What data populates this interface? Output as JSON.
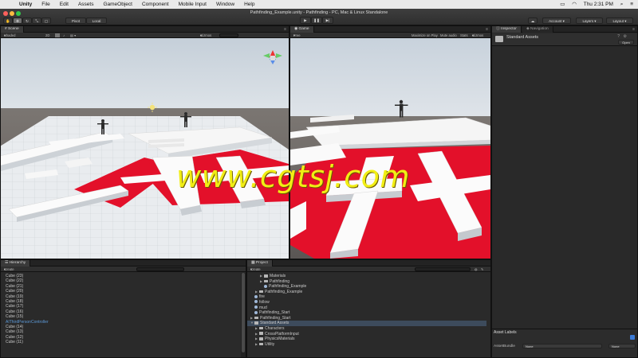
{
  "menubar": {
    "apple_icon": "apple-icon",
    "items": [
      "Unity",
      "File",
      "Edit",
      "Assets",
      "GameObject",
      "Component",
      "Mobile Input",
      "Window",
      "Help"
    ],
    "clock": "Thu 2:31 PM"
  },
  "window": {
    "title": "Pathfinding_Example.unity - Pathfinding - PC, Mac & Linux Standalone"
  },
  "toolbar": {
    "pivot": "Pivot",
    "local": "Local",
    "account": "Account",
    "layers": "Layers",
    "layout": "Layout"
  },
  "scene": {
    "tab": "Scene",
    "shading": "Shaded",
    "mode_2d": "2D",
    "gizmos": "Gizmos"
  },
  "game": {
    "tab": "Game",
    "aspect": "Free Aspect",
    "maximize": "Maximize on Play",
    "mute": "Mute audio",
    "stats": "Stats",
    "gizmos": "Gizmos",
    "watermark": "www.cgtsj.com"
  },
  "inspector": {
    "tab": "Inspector",
    "nav_tab": "Navigation",
    "item": "Standard Assets",
    "open_button": "Open",
    "asset_labels": "Asset Labels",
    "asset_bundle_label": "AssetBundle",
    "bundle_value": "None",
    "variant_value": "None"
  },
  "hierarchy": {
    "tab": "Hierarchy",
    "create": "Create",
    "items": [
      {
        "label": "Cube (23)",
        "style": ""
      },
      {
        "label": "Cube (22)",
        "style": ""
      },
      {
        "label": "Cube (21)",
        "style": ""
      },
      {
        "label": "Cube (20)",
        "style": ""
      },
      {
        "label": "Cube (19)",
        "style": ""
      },
      {
        "label": "Cube (18)",
        "style": ""
      },
      {
        "label": "Cube (17)",
        "style": ""
      },
      {
        "label": "Cube (16)",
        "style": ""
      },
      {
        "label": "Cube (15)",
        "style": ""
      },
      {
        "label": "AIThirdPersonController",
        "style": "blue"
      },
      {
        "label": "Cube (14)",
        "style": ""
      },
      {
        "label": "Cube (13)",
        "style": ""
      },
      {
        "label": "Cube (12)",
        "style": ""
      },
      {
        "label": "Cube (11)",
        "style": ""
      }
    ]
  },
  "project": {
    "tab": "Project",
    "create": "Create",
    "items": [
      {
        "label": "Materials",
        "indent": 2,
        "kind": "folder",
        "arrow": "▶"
      },
      {
        "label": "Pathfinding",
        "indent": 2,
        "kind": "folder",
        "arrow": "▶"
      },
      {
        "label": "Pathfinding_Example",
        "indent": 2,
        "kind": "scene",
        "arrow": ""
      },
      {
        "label": "Pathfinding_Example",
        "indent": 1,
        "kind": "folder",
        "arrow": "▶"
      },
      {
        "label": "fire",
        "indent": 0,
        "kind": "scene",
        "arrow": ""
      },
      {
        "label": "follow",
        "indent": 0,
        "kind": "scene",
        "arrow": ""
      },
      {
        "label": "mud",
        "indent": 0,
        "kind": "scene",
        "arrow": ""
      },
      {
        "label": "Pathfinding_Start",
        "indent": 0,
        "kind": "scene",
        "arrow": ""
      },
      {
        "label": "Pathfinding_Start",
        "indent": 0,
        "kind": "folder",
        "arrow": "▶"
      },
      {
        "label": "Standard Assets",
        "indent": 0,
        "kind": "folder",
        "arrow": "▼",
        "selected": true
      },
      {
        "label": "Characters",
        "indent": 1,
        "kind": "folder",
        "arrow": "▶"
      },
      {
        "label": "CrossPlatformInput",
        "indent": 1,
        "kind": "folder",
        "arrow": "▶"
      },
      {
        "label": "PhysicsMaterials",
        "indent": 1,
        "kind": "folder",
        "arrow": "▶"
      },
      {
        "label": "Utility",
        "indent": 1,
        "kind": "folder",
        "arrow": "▶"
      }
    ]
  },
  "colors": {
    "accent_red": "#e3102a",
    "watermark": "#f1ee14",
    "sky": "#c9d4de",
    "ground": "#6f6a66"
  }
}
